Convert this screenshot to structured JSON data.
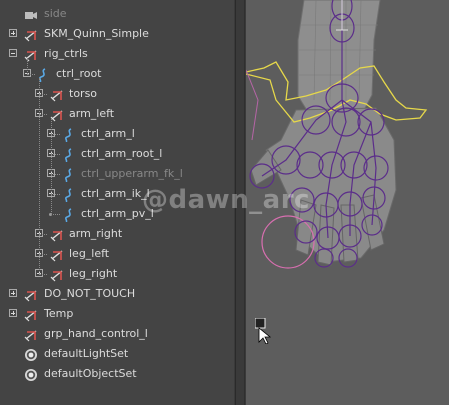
{
  "outliner": {
    "items": [
      {
        "label": "side",
        "icon": "camera-icon",
        "depth": 0,
        "expander": "none",
        "dim": true
      },
      {
        "label": "SKM_Quinn_Simple",
        "icon": "group-icon",
        "depth": 0,
        "expander": "collapsed"
      },
      {
        "label": "rig_ctrls",
        "icon": "group-icon",
        "depth": 0,
        "expander": "expanded"
      },
      {
        "label": "ctrl_root",
        "icon": "curve-icon",
        "depth": 1,
        "expander": "expanded"
      },
      {
        "label": "torso",
        "icon": "group-icon",
        "depth": 2,
        "expander": "collapsed"
      },
      {
        "label": "arm_left",
        "icon": "group-icon",
        "depth": 2,
        "expander": "expanded"
      },
      {
        "label": "ctrl_arm_l",
        "icon": "curve-icon",
        "depth": 3,
        "expander": "collapsed"
      },
      {
        "label": "ctrl_arm_root_l",
        "icon": "curve-icon",
        "depth": 3,
        "expander": "collapsed"
      },
      {
        "label": "ctrl_upperarm_fk_l",
        "icon": "curve-icon",
        "depth": 3,
        "expander": "collapsed",
        "dim": true
      },
      {
        "label": "ctrl_arm_ik_l",
        "icon": "curve-icon",
        "depth": 3,
        "expander": "collapsed"
      },
      {
        "label": "ctrl_arm_pv_l",
        "icon": "curve-icon",
        "depth": 3,
        "expander": "leaf"
      },
      {
        "label": "arm_right",
        "icon": "group-icon",
        "depth": 2,
        "expander": "collapsed"
      },
      {
        "label": "leg_left",
        "icon": "group-icon",
        "depth": 2,
        "expander": "collapsed"
      },
      {
        "label": "leg_right",
        "icon": "group-icon",
        "depth": 2,
        "expander": "collapsed"
      },
      {
        "label": "DO_NOT_TOUCH",
        "icon": "group-icon",
        "depth": 0,
        "expander": "collapsed"
      },
      {
        "label": "Temp",
        "icon": "group-icon",
        "depth": 0,
        "expander": "collapsed"
      },
      {
        "label": "grp_hand_control_l",
        "icon": "group-icon",
        "depth": 0,
        "expander": "none"
      },
      {
        "label": "defaultLightSet",
        "icon": "set-icon",
        "depth": 0,
        "expander": "none"
      },
      {
        "label": "defaultObjectSet",
        "icon": "set-icon",
        "depth": 0,
        "expander": "none"
      }
    ]
  },
  "watermark": {
    "text": "@dawn_arc"
  },
  "colors": {
    "panel_bg": "#444444",
    "viewport_bg": "#5d5d5d",
    "label": "#dcdcdc",
    "label_dim": "#888888",
    "curve_icon": "#5aa9e6",
    "group_icon_red": "#d9534f",
    "joint_purple": "#5b2d8a",
    "curve_yellow": "#e6d84a",
    "curve_pink": "#d86fb0"
  }
}
